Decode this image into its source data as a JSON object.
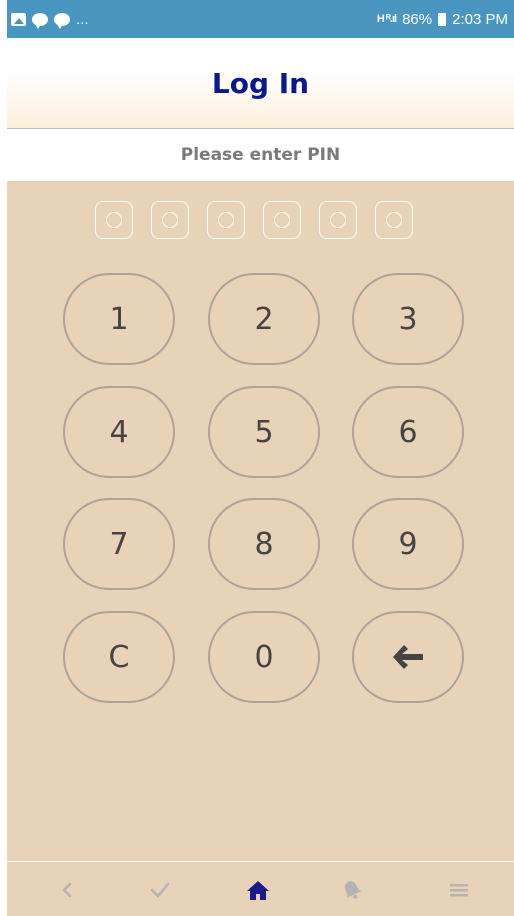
{
  "status_bar": {
    "left_dots": "...",
    "signal": "H ᴿ.ıl",
    "battery_percent": "86%",
    "time": "2:03 PM",
    "icons": [
      "gallery-icon",
      "line-app-icon",
      "line-app-icon"
    ]
  },
  "header": {
    "title": "Log In"
  },
  "prompt": "Please enter PIN",
  "pin": {
    "length": 6,
    "entered": 0
  },
  "keypad": {
    "k1": "1",
    "k2": "2",
    "k3": "3",
    "k4": "4",
    "k5": "5",
    "k6": "6",
    "k7": "7",
    "k8": "8",
    "k9": "9",
    "clear": "C",
    "k0": "0",
    "backspace_icon": "arrow-left-icon"
  },
  "bottom_nav": {
    "items": [
      "back-icon",
      "check-icon",
      "home-icon",
      "bell-icon",
      "menu-icon"
    ],
    "active": "home-icon",
    "colors": {
      "active": "#1a1a8c",
      "inactive": "#b4b4b4"
    }
  },
  "colors": {
    "status_bar": "#4a96c0",
    "title": "#0a1a8a",
    "keypad_bg": "#e8d3b9",
    "key_border": "#a9a39c"
  }
}
